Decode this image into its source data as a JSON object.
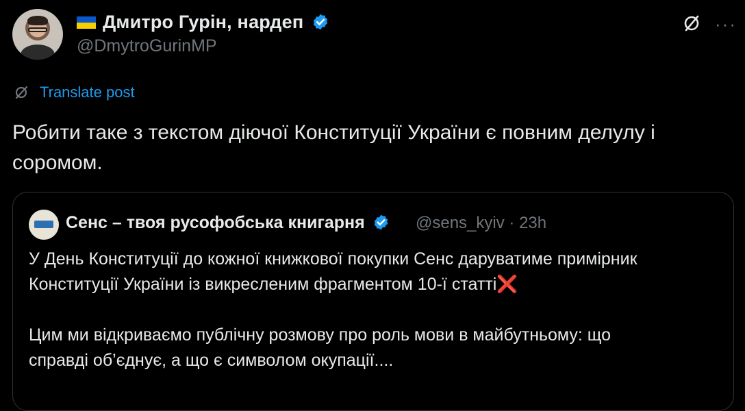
{
  "author": {
    "flag_icon": "ukraine-flag",
    "name": "Дмитро Гурін, нардеп",
    "handle": "@DmytroGurinMP"
  },
  "header_icons": {
    "grok": "grok-icon",
    "more": "···"
  },
  "translate": {
    "label": "Translate post"
  },
  "tweet": {
    "text": "Робити таке з текстом діючої Конституції України є повним делулу і соромом."
  },
  "quote": {
    "name": "Сенс – твоя русофобська книгарня",
    "handle_time": "@sens_kyiv · 23h",
    "line1": "У День Конституції до кожної книжкової покупки Сенс даруватиме примірник",
    "line2": "Конституції України із викресленим фрагментом 10-ї статті",
    "cross_emoji": "❌",
    "line3": "Цим ми відкриваємо публічну розмову про роль мови в майбутньому: що",
    "line4": "справді об’єднує, а що є символом окупації...."
  },
  "colors": {
    "background": "#000000",
    "text": "#e7e9ea",
    "secondary": "#71767b",
    "link": "#1d9bf0",
    "verified": "#1d9bf0",
    "border": "#2f3336"
  }
}
